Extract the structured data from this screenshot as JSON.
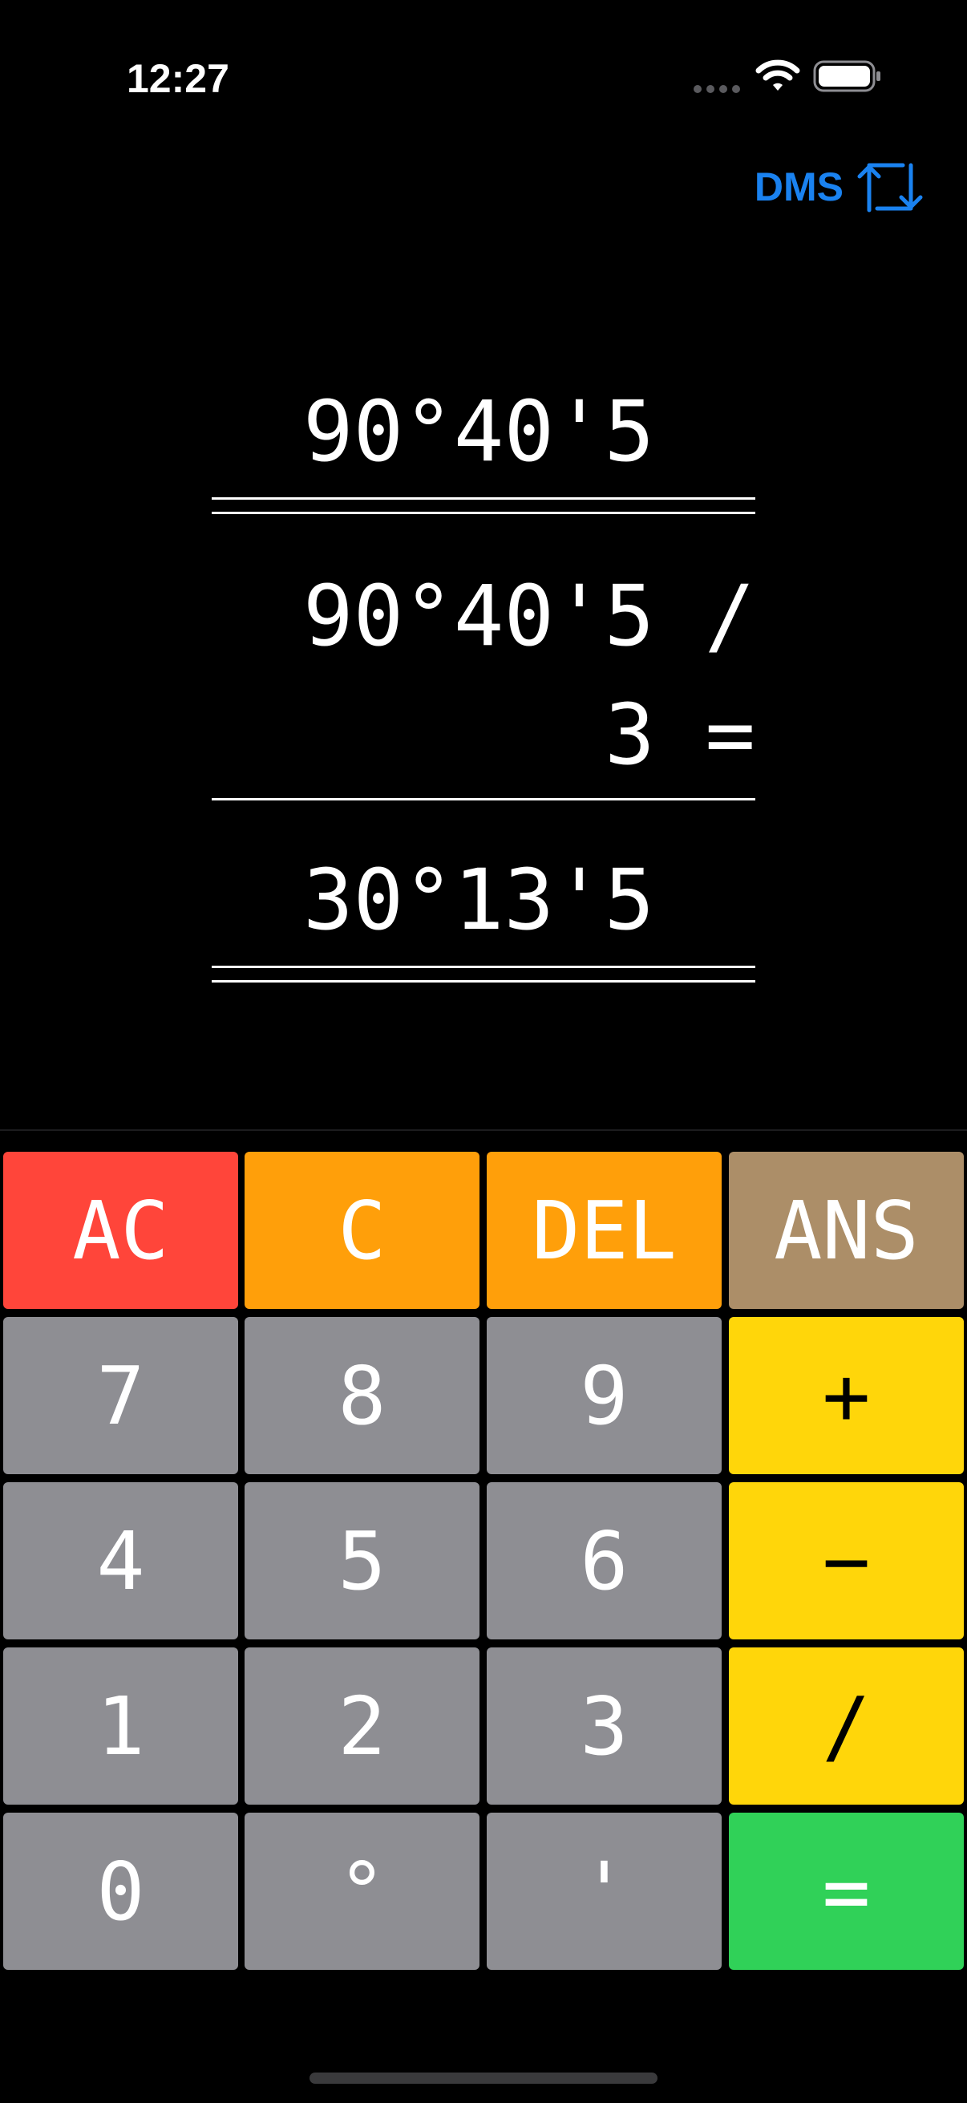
{
  "status_bar": {
    "time": "12:27"
  },
  "header": {
    "mode_label": "DMS",
    "mode_icon": "swap-arrows-icon",
    "accent_color": "#1a82f0"
  },
  "display": {
    "previous_answer": "90°40'5",
    "expression_line1": "90°40'5 /",
    "expression_line2": "3 =",
    "result": "30°13'5"
  },
  "keypad": {
    "rows": [
      [
        {
          "label": "AC",
          "kind": "clear",
          "color": "#ff453a"
        },
        {
          "label": "C",
          "kind": "clear-entry",
          "color": "#ff9f0a"
        },
        {
          "label": "DEL",
          "kind": "delete",
          "color": "#ff9f0a"
        },
        {
          "label": "ANS",
          "kind": "answer",
          "color": "#ac8e68"
        }
      ],
      [
        {
          "label": "7",
          "kind": "digit",
          "color": "#8e8e93"
        },
        {
          "label": "8",
          "kind": "digit",
          "color": "#8e8e93"
        },
        {
          "label": "9",
          "kind": "digit",
          "color": "#8e8e93"
        },
        {
          "label": "+",
          "kind": "operator",
          "color": "#ffd60a"
        }
      ],
      [
        {
          "label": "4",
          "kind": "digit",
          "color": "#8e8e93"
        },
        {
          "label": "5",
          "kind": "digit",
          "color": "#8e8e93"
        },
        {
          "label": "6",
          "kind": "digit",
          "color": "#8e8e93"
        },
        {
          "label": "−",
          "kind": "operator",
          "color": "#ffd60a"
        }
      ],
      [
        {
          "label": "1",
          "kind": "digit",
          "color": "#8e8e93"
        },
        {
          "label": "2",
          "kind": "digit",
          "color": "#8e8e93"
        },
        {
          "label": "3",
          "kind": "digit",
          "color": "#8e8e93"
        },
        {
          "label": "/",
          "kind": "operator",
          "color": "#ffd60a"
        }
      ],
      [
        {
          "label": "0",
          "kind": "digit",
          "color": "#8e8e93"
        },
        {
          "label": "°",
          "kind": "degree",
          "color": "#8e8e93"
        },
        {
          "label": "'",
          "kind": "minute",
          "color": "#8e8e93"
        },
        {
          "label": "=",
          "kind": "equals",
          "color": "#30d158"
        }
      ]
    ]
  }
}
